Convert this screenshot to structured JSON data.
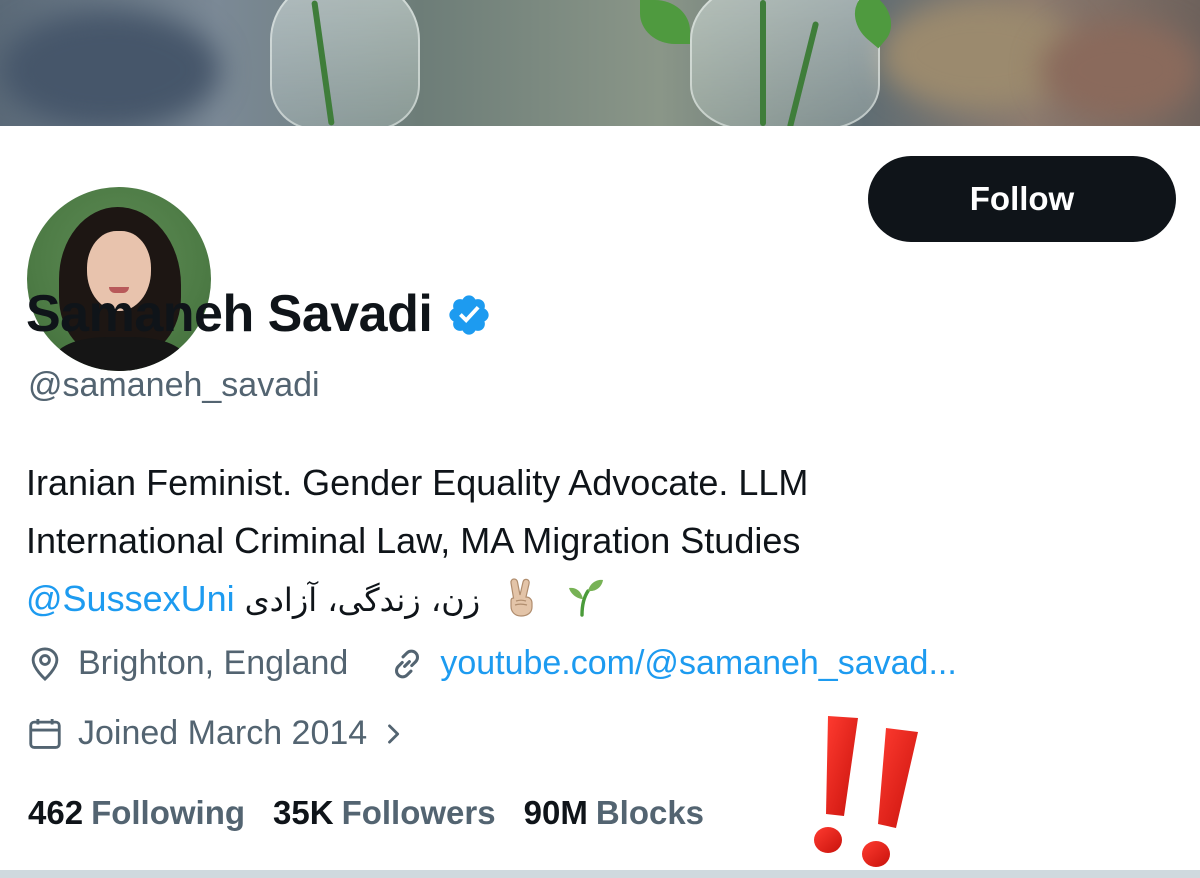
{
  "banner": {
    "icon": "banner-image-plants-in-glass-jars"
  },
  "avatar": {
    "icon": "profile-photo"
  },
  "follow_button": {
    "label": "Follow"
  },
  "profile": {
    "display_name": "Samaneh Savadi",
    "verified": true,
    "handle": "@samaneh_savadi"
  },
  "bio": {
    "line1": "Iranian Feminist. Gender Equality Advocate. LLM",
    "line2": "International Criminal Law, MA Migration Studies",
    "mention": "@SussexUni",
    "persian": "زن، زندگی، آزادی",
    "emojis": [
      "victory-hand",
      "seedling"
    ]
  },
  "meta": {
    "location": "Brighton, England",
    "website": "youtube.com/@samaneh_savad...",
    "joined": "Joined March 2014"
  },
  "stats": [
    {
      "count": "462",
      "label": "Following"
    },
    {
      "count": "35K",
      "label": "Followers"
    },
    {
      "count": "90M",
      "label": "Blocks"
    }
  ],
  "colors": {
    "accent": "#1d9bf0",
    "text": "#0f1419",
    "secondary": "#536471",
    "button": "#0f1419",
    "exclamation": "#e0201a"
  }
}
